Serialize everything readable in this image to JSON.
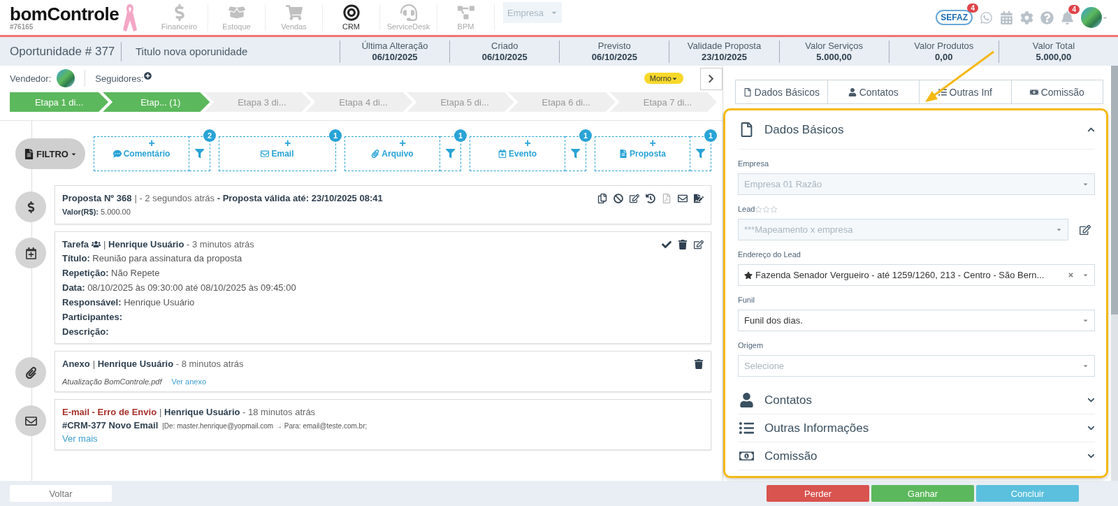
{
  "brand": {
    "name": "bomControle",
    "account": "#76165"
  },
  "modules": [
    {
      "label": "Financeiro",
      "kind": "finance",
      "selected": false
    },
    {
      "label": "Estoque",
      "kind": "stock",
      "selected": false
    },
    {
      "label": "Vendas",
      "kind": "sales",
      "selected": false
    },
    {
      "label": "CRM",
      "kind": "crm",
      "selected": true
    },
    {
      "label": "ServiceDesk",
      "kind": "desk",
      "selected": false
    },
    {
      "label": "BPM",
      "kind": "bpm",
      "selected": false
    }
  ],
  "company_select": {
    "placeholder": "Empresa"
  },
  "header_icons": [
    {
      "kind": "sefaz",
      "label": "SEFAZ",
      "badge": "4"
    },
    {
      "kind": "whatsapp"
    },
    {
      "kind": "calendar"
    },
    {
      "kind": "settings"
    },
    {
      "kind": "help"
    },
    {
      "kind": "bell",
      "badge": "4"
    },
    {
      "kind": "avatar"
    }
  ],
  "opportunity": {
    "number": "Oportunidade # 377",
    "title": "Titulo nova oporunidade"
  },
  "summary": [
    {
      "label": "Última Alteração",
      "value": "06/10/2025"
    },
    {
      "label": "Criado",
      "value": "06/10/2025"
    },
    {
      "label": "Previsto",
      "value": "06/10/2025"
    },
    {
      "label": "Validade Proposta",
      "value": "23/10/2025"
    },
    {
      "label": "Valor Serviços",
      "value": "5.000,00"
    },
    {
      "label": "Valor Produtos",
      "value": "0,00"
    },
    {
      "label": "Valor Total",
      "value": "5.000,00"
    }
  ],
  "vendor_label": "Vendedor:",
  "followers_label": "Seguidores:",
  "temperature": "Morno",
  "stages": [
    {
      "label": "Etapa 1 di...",
      "done": true
    },
    {
      "label": "Etap... (1)",
      "done": true
    },
    {
      "label": "Etapa 3 di...",
      "done": false
    },
    {
      "label": "Etapa 4 di...",
      "done": false
    },
    {
      "label": "Etapa 5 di...",
      "done": false
    },
    {
      "label": "Etapa 6 di...",
      "done": false
    },
    {
      "label": "Etapa 7 di...",
      "done": false
    }
  ],
  "filter_button": "FILTRO",
  "activity_types": [
    {
      "label": "Comentário",
      "kind": "comment",
      "add_symbol": "+",
      "count": "2",
      "filter": true
    },
    {
      "label": "Email",
      "kind": "email",
      "add_symbol": "+",
      "count": "1",
      "filter": false
    },
    {
      "label": "Arquivo",
      "kind": "file",
      "add_symbol": "+",
      "count": "1",
      "filter": true
    },
    {
      "label": "Evento",
      "kind": "event",
      "add_symbol": "+",
      "count": "1",
      "filter": true
    },
    {
      "label": "Proposta",
      "kind": "proposal",
      "add_symbol": "+",
      "count": "1",
      "filter": true
    }
  ],
  "timeline": [
    {
      "kind": "proposal",
      "title": "Proposta Nº 368",
      "error": false,
      "meta": "| - 2 segundos atrás **- Proposta válida até: 23/10/2025 08:41**",
      "lines": [
        "**Valor(R$):** 5.000.00"
      ]
    },
    {
      "kind": "task",
      "title": "Tarefa",
      "error": false,
      "meta": "| **Henrique Usuário** - 3 minutos atrás",
      "lines": [
        "**Título:** Reunião para assinatura da proposta",
        "**Repetição:** Não Repete",
        "**Data:** 08/10/2025 às 09:30:00 até 08/10/2025 às 09:45:00",
        "**Responsável:** Henrique Usuário",
        "**Participantes:**",
        "**Descrição:**"
      ]
    },
    {
      "kind": "attachment",
      "title": "Anexo",
      "error": false,
      "meta": "| **Henrique Usuário** - 8 minutos atrás",
      "file": "Atualização BomControle.pdf",
      "link": "Ver anexo"
    },
    {
      "kind": "email",
      "title": "E-mail - Erro de Envio",
      "error": true,
      "meta": "| **Henrique Usuário** - 18 minutos atrás",
      "subject": "#CRM-377 Novo Email",
      "route": "|De: master.henrique@yopmail.com → Para: email@teste.com.br;",
      "link": "Ver mais"
    }
  ],
  "panel_tabs": [
    {
      "label": "Dados Básicos",
      "kind": "file"
    },
    {
      "label": "Contatos",
      "kind": "user"
    },
    {
      "label": "Outras Inf",
      "kind": "list"
    },
    {
      "label": "Comissão",
      "kind": "money"
    }
  ],
  "sections": [
    {
      "title": "Dados Básicos",
      "kind": "file",
      "expanded": true,
      "fields": [
        {
          "label": "Empresa",
          "value": "Empresa 01 Razão",
          "disabled": true,
          "clearable": false,
          "edit": false
        },
        {
          "label": "Lead",
          "stars": 0,
          "value": "***Mapeamento x empresa",
          "disabled": true,
          "clearable": false,
          "edit": true
        },
        {
          "label": "Endereço do Lead",
          "value": "Fazenda Senador Vergueiro - até 1259/1260, 213 - Centro - São Bern...",
          "disabled": false,
          "clearable": true,
          "edit": false
        },
        {
          "label": "Funil",
          "value": "Funil dos dias.",
          "disabled": false,
          "clearable": false,
          "edit": false
        },
        {
          "label": "Origem",
          "placeholder": "Selecione",
          "disabled": false,
          "clearable": false,
          "edit": false
        }
      ]
    },
    {
      "title": "Contatos",
      "kind": "user",
      "expanded": false
    },
    {
      "title": "Outras Informações",
      "kind": "list",
      "expanded": false
    },
    {
      "title": "Comissão",
      "kind": "money",
      "expanded": false
    }
  ],
  "back_button": "Voltar",
  "actions": [
    {
      "label": "Perder",
      "kind": "lose"
    },
    {
      "label": "Ganhar",
      "kind": "win"
    },
    {
      "label": "Concluir",
      "kind": "done"
    }
  ]
}
